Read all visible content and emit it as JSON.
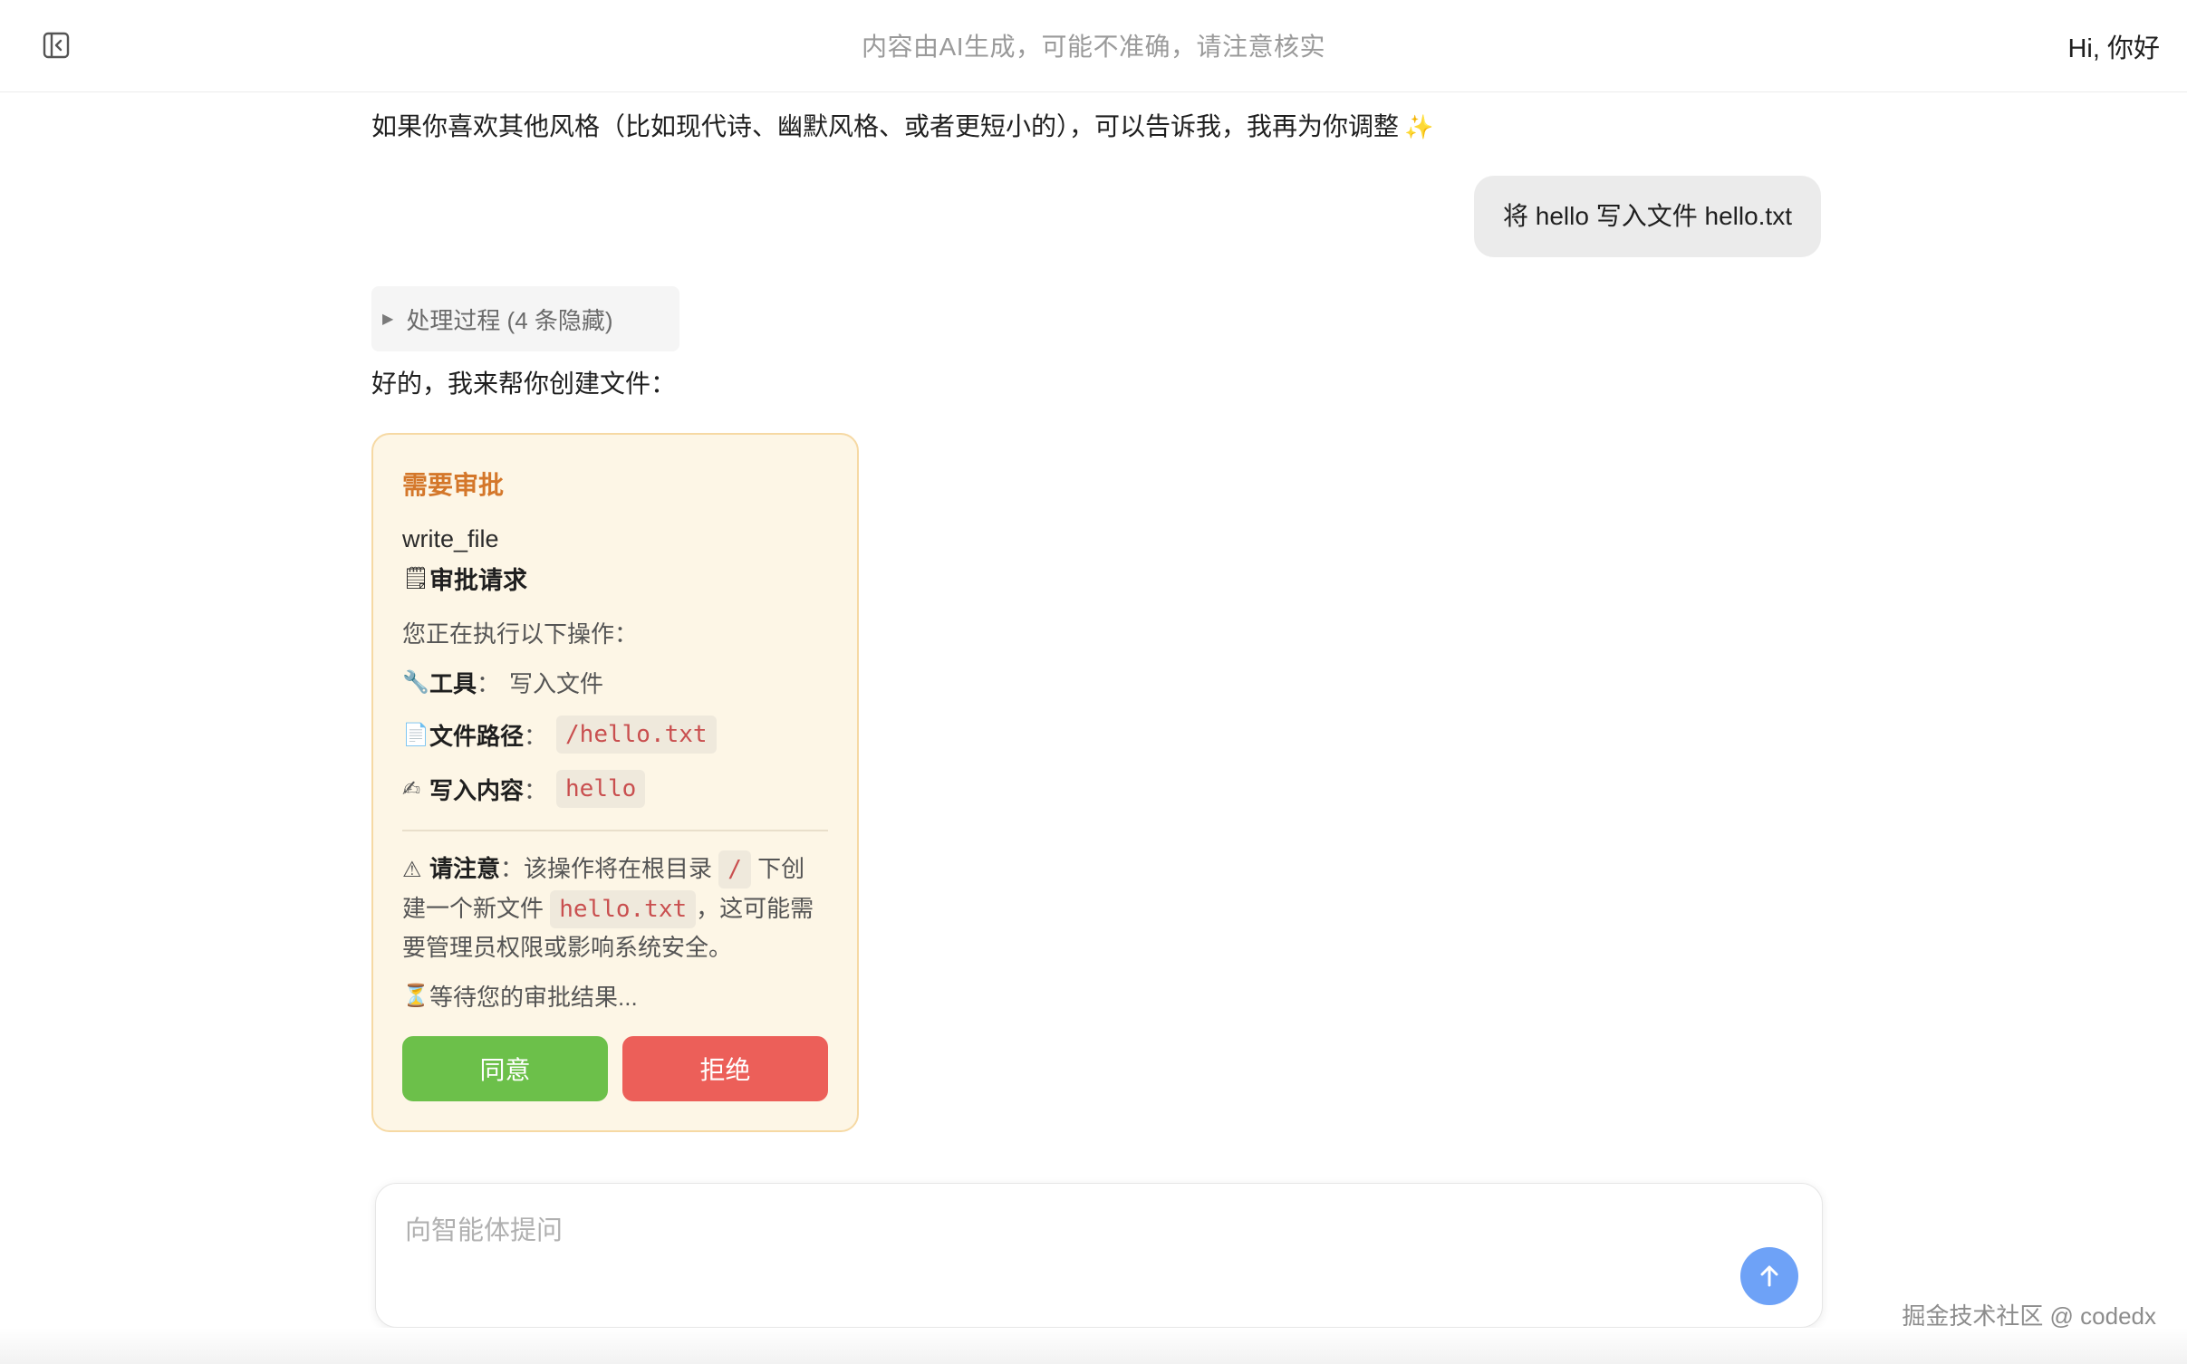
{
  "header": {
    "notice": "内容由AI生成，可能不准确，请注意核实",
    "greeting": "Hi, 你好"
  },
  "messages": {
    "assistant_prev": "如果你喜欢其他风格（比如现代诗、幽默风格、或者更短小的），可以告诉我，我再为你调整",
    "user": "将 hello 写入文件 hello.txt",
    "process_toggle": "处理过程 (4 条隐藏)",
    "assistant_reply": "好的，我来帮你创建文件："
  },
  "approval": {
    "title": "需要审批",
    "tool_name": "write_file",
    "request_label": "审批请求",
    "intro": "您正在执行以下操作：",
    "tool_key": "工具",
    "tool_value": "写入文件",
    "path_key": "文件路径",
    "path_value": "/hello.txt",
    "content_key": "写入内容",
    "content_value": "hello",
    "warn_key": "请注意",
    "warn_text_1": "该操作将在根目录",
    "warn_code_1": "/",
    "warn_text_2": "下创建一个新文件",
    "warn_code_2": "hello.txt",
    "warn_text_3": "，这可能需要管理员权限或影响系统安全。",
    "waiting": "等待您的审批结果...",
    "approve_label": "同意",
    "reject_label": "拒绝"
  },
  "input": {
    "placeholder": "向智能体提问"
  },
  "watermark": "掘金技术社区 @ codedx",
  "colors": {
    "approve": "#6cc04a",
    "reject": "#ec5f59",
    "card_title": "#d4772a",
    "send_button": "#6ea2f7"
  }
}
